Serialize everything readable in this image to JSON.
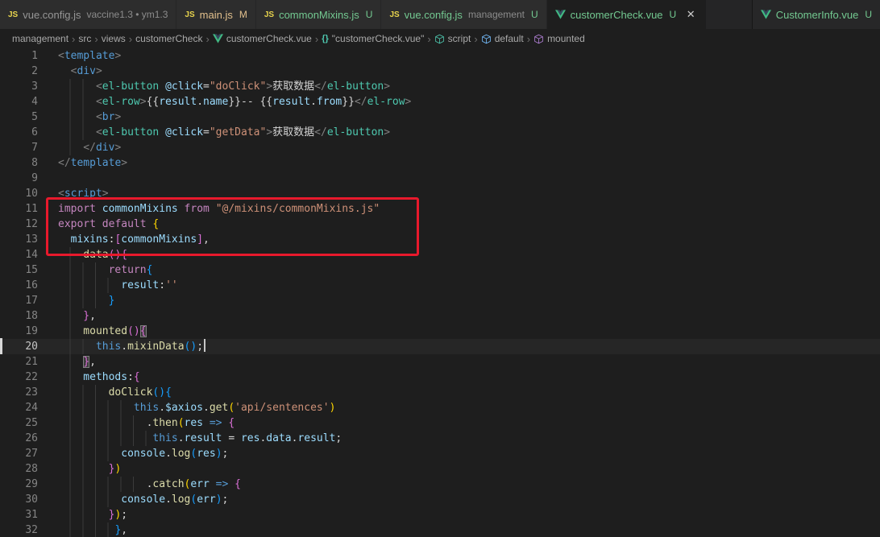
{
  "colors": {
    "modified": "#e2c08d",
    "untracked": "#73c991",
    "tab_inactive_fg": "#969696",
    "tab_active_fg": "#d7d7d7",
    "desc_fg": "#8c8c8c",
    "breadcrumb_fg": "#a9a9a9",
    "annotation_red": "#e8192c",
    "symbol_script": "#4ec9b0",
    "symbol_default": "#75beff",
    "symbol_mounted": "#b180d7",
    "vue_green": "#41b883",
    "vue_dark": "#35495e",
    "js_yellow": "#e8d44d",
    "edge_marker": "#d8d8d8"
  },
  "icons": {
    "js_text": "JS",
    "braces_text": "{}",
    "close_glyph": "✕"
  },
  "tabs": {
    "left": [
      {
        "icon": "js",
        "label": "vue.config.js",
        "desc": "vaccine1.3 • ym1.3"
      },
      {
        "icon": "js",
        "label": "main.js",
        "badge": "M",
        "git": "modified"
      },
      {
        "icon": "js",
        "label": "commonMixins.js",
        "badge": "U",
        "git": "untracked"
      },
      {
        "icon": "js",
        "label": "vue.config.js",
        "desc": "management",
        "badge": "U",
        "git": "untracked"
      },
      {
        "icon": "vue",
        "label": "customerCheck.vue",
        "badge": "U",
        "git": "untracked",
        "active": true
      }
    ],
    "right": [
      {
        "icon": "vue",
        "label": "CustomerInfo.vue",
        "badge": "U",
        "git": "untracked"
      }
    ]
  },
  "breadcrumbs": {
    "separator": "›",
    "items": [
      {
        "label": "management"
      },
      {
        "label": "src"
      },
      {
        "label": "views"
      },
      {
        "label": "customerCheck"
      },
      {
        "label": "customerCheck.vue",
        "icon": "vue"
      },
      {
        "label": "\"customerCheck.vue\"",
        "icon": "braces"
      },
      {
        "label": "script",
        "icon": "symbol-script"
      },
      {
        "label": "default",
        "icon": "symbol-default"
      },
      {
        "label": "mounted",
        "icon": "symbol-mounted"
      }
    ]
  },
  "annotation": {
    "type": "red-box",
    "around_lines": "11-13",
    "color": "#e8192c"
  },
  "editor": {
    "cursor_line": 20,
    "line_number_fg": "#858585",
    "line_number_active_fg": "#c6c6c6",
    "token_colors": {
      "pu": "#808080",
      "tag": "#569cd6",
      "comp": "#4ec9b0",
      "attr": "#9cdcfe",
      "str": "#ce9178",
      "txt": "#d4d4d4",
      "kw": "#c586c0",
      "var": "#9cdcfe",
      "fn": "#dcdcaa",
      "kb": "#569cd6",
      "b1": "#ffd700",
      "b2": "#da70d6",
      "b3": "#179fff",
      "op": "#d4d4d4"
    },
    "lines": [
      {
        "n": 1,
        "i": 0,
        "t": [
          [
            "pu",
            "<"
          ],
          [
            "tag",
            "template"
          ],
          [
            "pu",
            ">"
          ]
        ]
      },
      {
        "n": 2,
        "i": 2,
        "t": [
          [
            "pu",
            "<"
          ],
          [
            "tag",
            "div"
          ],
          [
            "pu",
            ">"
          ]
        ]
      },
      {
        "n": 3,
        "i": 6,
        "t": [
          [
            "pu",
            "<"
          ],
          [
            "comp",
            "el-button"
          ],
          [
            "txt",
            " "
          ],
          [
            "attr",
            "@click"
          ],
          [
            "op",
            "="
          ],
          [
            "str",
            "\"doClick\""
          ],
          [
            "pu",
            ">"
          ],
          [
            "txt",
            "获取数据"
          ],
          [
            "pu",
            "</"
          ],
          [
            "comp",
            "el-button"
          ],
          [
            "pu",
            ">"
          ]
        ]
      },
      {
        "n": 4,
        "i": 6,
        "t": [
          [
            "pu",
            "<"
          ],
          [
            "comp",
            "el-row"
          ],
          [
            "pu",
            ">"
          ],
          [
            "txt",
            "{{"
          ],
          [
            "var",
            "result"
          ],
          [
            "op",
            "."
          ],
          [
            "var",
            "name"
          ],
          [
            "txt",
            "}}-- {{"
          ],
          [
            "var",
            "result"
          ],
          [
            "op",
            "."
          ],
          [
            "var",
            "from"
          ],
          [
            "txt",
            "}}"
          ],
          [
            "pu",
            "</"
          ],
          [
            "comp",
            "el-row"
          ],
          [
            "pu",
            ">"
          ]
        ]
      },
      {
        "n": 5,
        "i": 6,
        "t": [
          [
            "pu",
            "<"
          ],
          [
            "tag",
            "br"
          ],
          [
            "pu",
            ">"
          ]
        ]
      },
      {
        "n": 6,
        "i": 6,
        "t": [
          [
            "pu",
            "<"
          ],
          [
            "comp",
            "el-button"
          ],
          [
            "txt",
            " "
          ],
          [
            "attr",
            "@click"
          ],
          [
            "op",
            "="
          ],
          [
            "str",
            "\"getData\""
          ],
          [
            "pu",
            ">"
          ],
          [
            "txt",
            "获取数据"
          ],
          [
            "pu",
            "</"
          ],
          [
            "comp",
            "el-button"
          ],
          [
            "pu",
            ">"
          ]
        ]
      },
      {
        "n": 7,
        "i": 4,
        "t": [
          [
            "pu",
            "</"
          ],
          [
            "tag",
            "div"
          ],
          [
            "pu",
            ">"
          ]
        ]
      },
      {
        "n": 8,
        "i": 0,
        "t": [
          [
            "pu",
            "</"
          ],
          [
            "tag",
            "template"
          ],
          [
            "pu",
            ">"
          ]
        ]
      },
      {
        "n": 9,
        "i": 0,
        "t": []
      },
      {
        "n": 10,
        "i": 0,
        "t": [
          [
            "pu",
            "<"
          ],
          [
            "tag",
            "script"
          ],
          [
            "pu",
            ">"
          ]
        ]
      },
      {
        "n": 11,
        "i": 0,
        "t": [
          [
            "kw",
            "import"
          ],
          [
            "txt",
            " "
          ],
          [
            "var",
            "commonMixins"
          ],
          [
            "txt",
            " "
          ],
          [
            "kw",
            "from"
          ],
          [
            "txt",
            " "
          ],
          [
            "str",
            "\"@/mixins/commonMixins.js\""
          ]
        ]
      },
      {
        "n": 12,
        "i": 0,
        "t": [
          [
            "kw",
            "export"
          ],
          [
            "txt",
            " "
          ],
          [
            "kw",
            "default"
          ],
          [
            "txt",
            " "
          ],
          [
            "b1",
            "{"
          ]
        ]
      },
      {
        "n": 13,
        "i": 2,
        "t": [
          [
            "var",
            "mixins"
          ],
          [
            "op",
            ":"
          ],
          [
            "b2",
            "["
          ],
          [
            "var",
            "commonMixins"
          ],
          [
            "b2",
            "]"
          ],
          [
            "op",
            ","
          ]
        ]
      },
      {
        "n": 14,
        "i": 4,
        "t": [
          [
            "fn",
            "data"
          ],
          [
            "b2",
            "("
          ],
          [
            "b2",
            ")"
          ],
          [
            "b2",
            "{"
          ]
        ]
      },
      {
        "n": 15,
        "i": 8,
        "t": [
          [
            "kw",
            "return"
          ],
          [
            "b3",
            "{"
          ]
        ]
      },
      {
        "n": 16,
        "i": 10,
        "t": [
          [
            "var",
            "result"
          ],
          [
            "op",
            ":"
          ],
          [
            "str",
            "''"
          ]
        ]
      },
      {
        "n": 17,
        "i": 8,
        "t": [
          [
            "b3",
            "}"
          ]
        ]
      },
      {
        "n": 18,
        "i": 4,
        "t": [
          [
            "b2",
            "}"
          ],
          [
            "op",
            ","
          ]
        ]
      },
      {
        "n": 19,
        "i": 4,
        "t": [
          [
            "fn",
            "mounted"
          ],
          [
            "b2",
            "("
          ],
          [
            "b2",
            ")"
          ],
          [
            "b2",
            "{",
            "m"
          ]
        ]
      },
      {
        "n": 20,
        "i": 6,
        "cur": true,
        "cursor": true,
        "t": [
          [
            "kb",
            "this"
          ],
          [
            "op",
            "."
          ],
          [
            "fn",
            "mixinData"
          ],
          [
            "b3",
            "("
          ],
          [
            "b3",
            ")"
          ],
          [
            "op",
            ";"
          ]
        ]
      },
      {
        "n": 21,
        "i": 4,
        "t": [
          [
            "b2",
            "}",
            "m"
          ],
          [
            "op",
            ","
          ]
        ]
      },
      {
        "n": 22,
        "i": 4,
        "t": [
          [
            "var",
            "methods"
          ],
          [
            "op",
            ":"
          ],
          [
            "b2",
            "{"
          ]
        ]
      },
      {
        "n": 23,
        "i": 8,
        "t": [
          [
            "fn",
            "doClick"
          ],
          [
            "b3",
            "("
          ],
          [
            "b3",
            ")"
          ],
          [
            "b3",
            "{"
          ]
        ]
      },
      {
        "n": 24,
        "i": 12,
        "t": [
          [
            "kb",
            "this"
          ],
          [
            "op",
            "."
          ],
          [
            "var",
            "$axios"
          ],
          [
            "op",
            "."
          ],
          [
            "fn",
            "get"
          ],
          [
            "b1",
            "("
          ],
          [
            "str",
            "'api/sentences'"
          ],
          [
            "b1",
            ")"
          ]
        ]
      },
      {
        "n": 25,
        "i": 14,
        "t": [
          [
            "op",
            "."
          ],
          [
            "fn",
            "then"
          ],
          [
            "b1",
            "("
          ],
          [
            "var",
            "res"
          ],
          [
            "txt",
            " "
          ],
          [
            "kb",
            "=>"
          ],
          [
            "txt",
            " "
          ],
          [
            "b2",
            "{"
          ]
        ]
      },
      {
        "n": 26,
        "i": 15,
        "t": [
          [
            "kb",
            "this"
          ],
          [
            "op",
            "."
          ],
          [
            "var",
            "result"
          ],
          [
            "txt",
            " "
          ],
          [
            "op",
            "="
          ],
          [
            "txt",
            " "
          ],
          [
            "var",
            "res"
          ],
          [
            "op",
            "."
          ],
          [
            "var",
            "data"
          ],
          [
            "op",
            "."
          ],
          [
            "var",
            "result"
          ],
          [
            "op",
            ";"
          ]
        ]
      },
      {
        "n": 27,
        "i": 10,
        "t": [
          [
            "var",
            "console"
          ],
          [
            "op",
            "."
          ],
          [
            "fn",
            "log"
          ],
          [
            "b3",
            "("
          ],
          [
            "var",
            "res"
          ],
          [
            "b3",
            ")"
          ],
          [
            "op",
            ";"
          ]
        ]
      },
      {
        "n": 28,
        "i": 8,
        "t": [
          [
            "b2",
            "}"
          ],
          [
            "b1",
            ")"
          ]
        ]
      },
      {
        "n": 29,
        "i": 14,
        "t": [
          [
            "op",
            "."
          ],
          [
            "fn",
            "catch"
          ],
          [
            "b1",
            "("
          ],
          [
            "var",
            "err"
          ],
          [
            "txt",
            " "
          ],
          [
            "kb",
            "=>"
          ],
          [
            "txt",
            " "
          ],
          [
            "b2",
            "{"
          ]
        ]
      },
      {
        "n": 30,
        "i": 10,
        "t": [
          [
            "var",
            "console"
          ],
          [
            "op",
            "."
          ],
          [
            "fn",
            "log"
          ],
          [
            "b3",
            "("
          ],
          [
            "var",
            "err"
          ],
          [
            "b3",
            ")"
          ],
          [
            "op",
            ";"
          ]
        ]
      },
      {
        "n": 31,
        "i": 8,
        "t": [
          [
            "b2",
            "}"
          ],
          [
            "b1",
            ")"
          ],
          [
            "op",
            ";"
          ]
        ]
      },
      {
        "n": 32,
        "i": 9,
        "t": [
          [
            "b3",
            "}"
          ],
          [
            "op",
            ","
          ]
        ]
      }
    ]
  }
}
